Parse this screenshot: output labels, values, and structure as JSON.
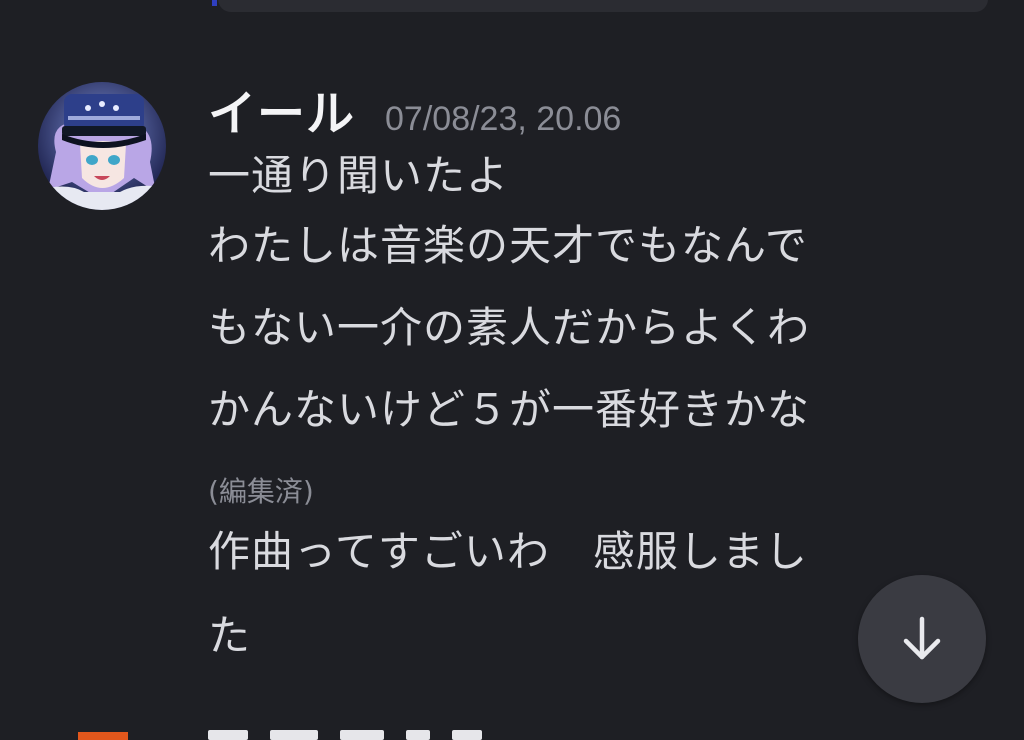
{
  "message": {
    "username": "イール",
    "timestamp": "07/08/23, 20.06",
    "lines": [
      "一通り聞いたよ",
      "わたしは音楽の天才でもなんで",
      "もない一介の素人だからよくわ",
      "かんないけど５が一番好きかな"
    ],
    "edited_label": "(編集済)",
    "reply_lines": [
      "作曲ってすごいわ　感服しまし",
      "た"
    ]
  },
  "icons": {
    "scroll_down": "arrow-down-icon",
    "avatar": "user-avatar"
  },
  "colors": {
    "background": "#1e1f24",
    "username": "#f4f4f6",
    "timestamp": "#8b8d96",
    "body_text": "#d9dadf",
    "scroll_button": "#3a3b42",
    "next_avatar": "#e2571c"
  }
}
